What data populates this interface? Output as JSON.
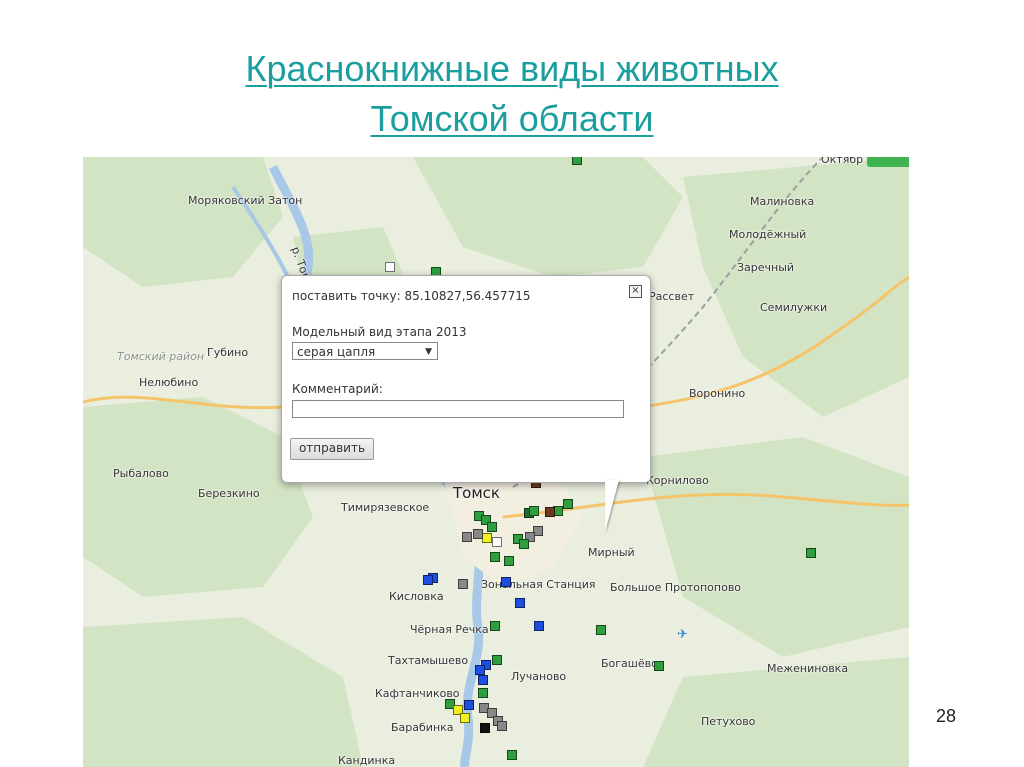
{
  "slide": {
    "title_line1": "Краснокнижные виды животных",
    "title_line2": "Томской области",
    "page_number": "28"
  },
  "map": {
    "colors": {
      "background": "#e9eede",
      "forest": "#d3e4c4",
      "river": "#a8c8e8",
      "highway": "#f5c46a",
      "city": "#f2eee0"
    },
    "places": {
      "moryakovsky_zaton": "Моряковский Затон",
      "river_tom": "р. Томь",
      "malinovka": "Малиновка",
      "molodezhny": "Молодёжный",
      "zarechny": "Заречный",
      "rassvet": "Рассвет",
      "semiluzhki": "Семилужки",
      "tomsky_rayon": "Томский район",
      "gubino": "Губино",
      "nelyubino": "Нелюбино",
      "voronino": "Воронино",
      "rybalovo": "Рыбалово",
      "berezkino": "Березкино",
      "kornilovo": "Корнилово",
      "tomsk": "Томск",
      "timiryazevskoe": "Тимирязевское",
      "mirny": "Мирный",
      "zonalnaya": "Зональная Станция",
      "kislovka": "Кисловка",
      "bolshoe_protopopovo": "Большое Протопопово",
      "chernaya_rechka": "Чёрная Речка",
      "bogashevo": "Богашёво",
      "takhtamyshevo": "Тахтамышево",
      "luchanovo": "Лучаново",
      "mezheninovka": "Межениновка",
      "kaftanchikovo": "Кафтанчиково",
      "barabinka": "Барабинка",
      "petukhovo": "Петухово",
      "kandinka": "Кандинка",
      "oktyabrsky": "Октябр"
    },
    "airport_icon": "airplane-icon"
  },
  "popup": {
    "coords_text": "поставить точку: 85.10827,56.457715",
    "close_icon": "close-icon",
    "close_glyph": "×",
    "species_label": "Модельный вид этапа 2013",
    "species_selected": "серая цапля",
    "comment_label": "Комментарий:",
    "comment_value": "",
    "submit_label": "отправить"
  },
  "marker_colors": {
    "green": "#2e9e3e",
    "blue": "#1f4fe0",
    "gray": "#888888",
    "brown": "#6b3a1e",
    "yellow": "#f0f020",
    "white": "#ffffff",
    "black": "#111111",
    "dark_green": "#1d6e2a"
  }
}
